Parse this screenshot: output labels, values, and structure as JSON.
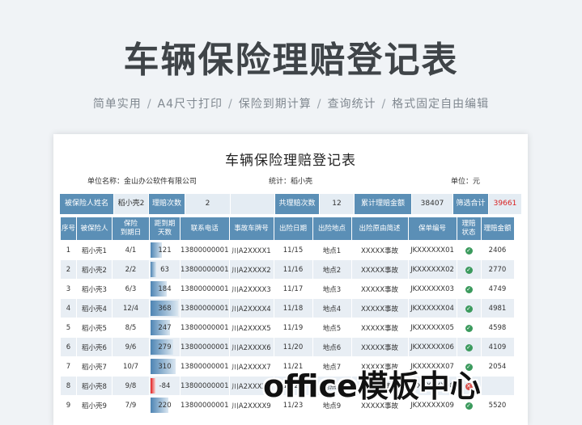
{
  "hero": {
    "title": "车辆保险理赔登记表",
    "features": [
      "简单实用",
      "A4尺寸打印",
      "保险到期计算",
      "查询统计",
      "格式固定自由编辑"
    ],
    "separator": "/"
  },
  "sheet": {
    "title": "车辆保险理赔登记表",
    "unit_name": "单位名称：金山办公软件有限公司",
    "stat": "统计：稻小壳",
    "unit": "单位：元"
  },
  "summary": {
    "insured_name_label": "被保险人姓名",
    "insured_name_value": "稻小壳2",
    "claim_count_label": "理赔次数",
    "claim_count_value": "2",
    "total_count_label": "共理赔次数",
    "total_count_value": "12",
    "total_amount_label": "累计理赔金额",
    "total_amount_value": "38407",
    "filter_total_label": "筛选合计",
    "filter_total_value": "39661"
  },
  "table": {
    "headers": [
      "序号",
      "被保险人",
      "保险\n到期日",
      "距到期\n天数",
      "联系电话",
      "事故车牌号",
      "出险日期",
      "出险地点",
      "出险原由简述",
      "保单编号",
      "理赔\n状态",
      "理赔金额"
    ],
    "rows": [
      {
        "no": "1",
        "name": "稻小壳1",
        "due": "4/1",
        "days": "121",
        "days_level": 0.4,
        "phone": "13800000001",
        "plate": "川A2XXXX1",
        "date": "11/15",
        "place": "地点1",
        "reason": "XXXXX事故",
        "policy": "JKXXXXXX01",
        "status": "check",
        "amount": "2406"
      },
      {
        "no": "2",
        "name": "稻小壳2",
        "due": "2/2",
        "days": "63",
        "days_level": 0.21,
        "phone": "13800000001",
        "plate": "川A2XXXX2",
        "date": "11/16",
        "place": "地点2",
        "reason": "XXXXX事故",
        "policy": "JKXXXXXX02",
        "status": "check",
        "amount": "2770"
      },
      {
        "no": "3",
        "name": "稻小壳3",
        "due": "6/3",
        "days": "184",
        "days_level": 0.6,
        "phone": "13800000001",
        "plate": "川A2XXXX3",
        "date": "11/17",
        "place": "地点3",
        "reason": "XXXXX事故",
        "policy": "JKXXXXXX03",
        "status": "check",
        "amount": "4749"
      },
      {
        "no": "4",
        "name": "稻小壳4",
        "due": "12/4",
        "days": "368",
        "days_level": 1.0,
        "phone": "13800000001",
        "plate": "川A2XXXX4",
        "date": "11/18",
        "place": "地点4",
        "reason": "XXXXX事故",
        "policy": "JKXXXXXX04",
        "status": "check",
        "amount": "4981"
      },
      {
        "no": "5",
        "name": "稻小壳5",
        "due": "8/5",
        "days": "247",
        "days_level": 0.72,
        "phone": "13800000001",
        "plate": "川A2XXXX5",
        "date": "11/19",
        "place": "地点5",
        "reason": "XXXXX事故",
        "policy": "JKXXXXXX05",
        "status": "check",
        "amount": "4598"
      },
      {
        "no": "6",
        "name": "稻小壳6",
        "due": "9/6",
        "days": "279",
        "days_level": 0.82,
        "phone": "13800000001",
        "plate": "川A2XXXX6",
        "date": "11/20",
        "place": "地点6",
        "reason": "XXXXX事故",
        "policy": "JKXXXXXX06",
        "status": "check",
        "amount": "4109"
      },
      {
        "no": "7",
        "name": "稻小壳7",
        "due": "10/7",
        "days": "310",
        "days_level": 0.9,
        "phone": "13800000001",
        "plate": "川A2XXXX7",
        "date": "11/21",
        "place": "地点7",
        "reason": "XXXXX事故",
        "policy": "JKXXXXXX07",
        "status": "check",
        "amount": "2054"
      },
      {
        "no": "8",
        "name": "稻小壳8",
        "due": "9/8",
        "days": "-84",
        "days_level": -0.24,
        "phone": "13800000001",
        "plate": "川A2XXXX8",
        "date": "11/22",
        "place": "地点8",
        "reason": "XXXXX事故",
        "policy": "JKXXXXXX08",
        "status": "x",
        "amount": ""
      },
      {
        "no": "9",
        "name": "稻小壳9",
        "due": "7/9",
        "days": "220",
        "days_level": 0.64,
        "phone": "13800000001",
        "plate": "川A2XXXX9",
        "date": "11/23",
        "place": "地点9",
        "reason": "XXXXX事故",
        "policy": "JKXXXXXX09",
        "status": "check",
        "amount": "5520"
      }
    ]
  },
  "watermark": "office模板中心",
  "colors": {
    "header_blue": "#5b8fb6",
    "row_alt": "#e8eef4",
    "status_green": "#3b9a5d",
    "negative_red": "#e21b1b",
    "filter_total_red": "#d81f1f"
  }
}
